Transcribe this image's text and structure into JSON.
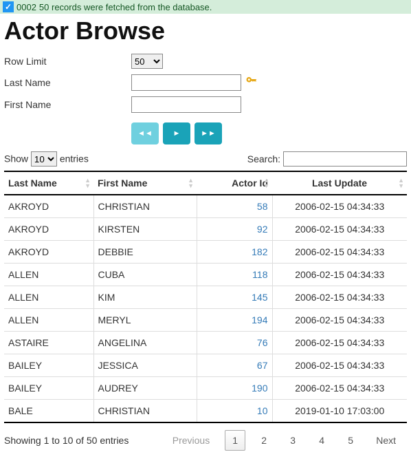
{
  "status": {
    "code": "0002",
    "message": "50 records were fetched from the database."
  },
  "page_title": "Actor Browse",
  "form": {
    "row_limit_label": "Row Limit",
    "row_limit_value": "50",
    "last_name_label": "Last Name",
    "last_name_value": "",
    "first_name_label": "First Name",
    "first_name_value": "",
    "nav_first": "◄◄",
    "nav_play": "►",
    "nav_last": "►►"
  },
  "table_controls": {
    "show_prefix": "Show",
    "show_value": "10",
    "show_suffix": "entries",
    "search_label": "Search:",
    "search_value": ""
  },
  "columns": {
    "c0": "Last Name",
    "c1": "First Name",
    "c2": "Actor Id",
    "c3": "Last Update"
  },
  "rows": [
    {
      "last": "AKROYD",
      "first": "CHRISTIAN",
      "id": "58",
      "upd": "2006-02-15 04:34:33"
    },
    {
      "last": "AKROYD",
      "first": "KIRSTEN",
      "id": "92",
      "upd": "2006-02-15 04:34:33"
    },
    {
      "last": "AKROYD",
      "first": "DEBBIE",
      "id": "182",
      "upd": "2006-02-15 04:34:33"
    },
    {
      "last": "ALLEN",
      "first": "CUBA",
      "id": "118",
      "upd": "2006-02-15 04:34:33"
    },
    {
      "last": "ALLEN",
      "first": "KIM",
      "id": "145",
      "upd": "2006-02-15 04:34:33"
    },
    {
      "last": "ALLEN",
      "first": "MERYL",
      "id": "194",
      "upd": "2006-02-15 04:34:33"
    },
    {
      "last": "ASTAIRE",
      "first": "ANGELINA",
      "id": "76",
      "upd": "2006-02-15 04:34:33"
    },
    {
      "last": "BAILEY",
      "first": "JESSICA",
      "id": "67",
      "upd": "2006-02-15 04:34:33"
    },
    {
      "last": "BAILEY",
      "first": "AUDREY",
      "id": "190",
      "upd": "2006-02-15 04:34:33"
    },
    {
      "last": "BALE",
      "first": "CHRISTIAN",
      "id": "10",
      "upd": "2019-01-10 17:03:00"
    }
  ],
  "pagination": {
    "info": "Showing 1 to 10 of 50 entries",
    "prev": "Previous",
    "next": "Next",
    "pages": [
      "1",
      "2",
      "3",
      "4",
      "5"
    ],
    "current": "1"
  }
}
